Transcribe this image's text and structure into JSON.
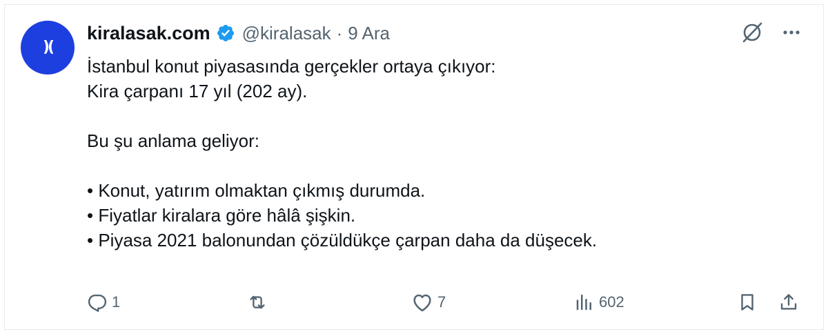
{
  "tweet": {
    "display_name": "kiralasak.com",
    "handle": "@kiralasak",
    "separator": "·",
    "date": "9 Ara",
    "avatar_text": ")(",
    "lines": [
      "İstanbul konut piyasasında gerçekler ortaya çıkıyor:",
      "Kira çarpanı 17 yıl (202 ay).",
      "",
      "Bu şu anlama geliyor:",
      "",
      "• Konut, yatırım olmaktan çıkmış durumda.",
      "• Fiyatlar kiralara göre hâlâ şişkin.",
      "• Piyasa 2021 balonundan çözüldükçe çarpan daha da düşecek."
    ]
  },
  "actions": {
    "replies": "1",
    "retweets": "",
    "likes": "7",
    "views": "602"
  },
  "icons": {
    "verified": "verified-badge-icon",
    "grok": "grok-icon",
    "more": "more-icon",
    "reply": "reply-icon",
    "retweet": "retweet-icon",
    "like": "heart-icon",
    "views": "views-icon",
    "bookmark": "bookmark-icon",
    "share": "share-icon"
  },
  "colors": {
    "verified_blue": "#1d9bf0",
    "avatar_bg": "#1d3fe0",
    "text_primary": "#0f1419",
    "text_secondary": "#536471"
  }
}
